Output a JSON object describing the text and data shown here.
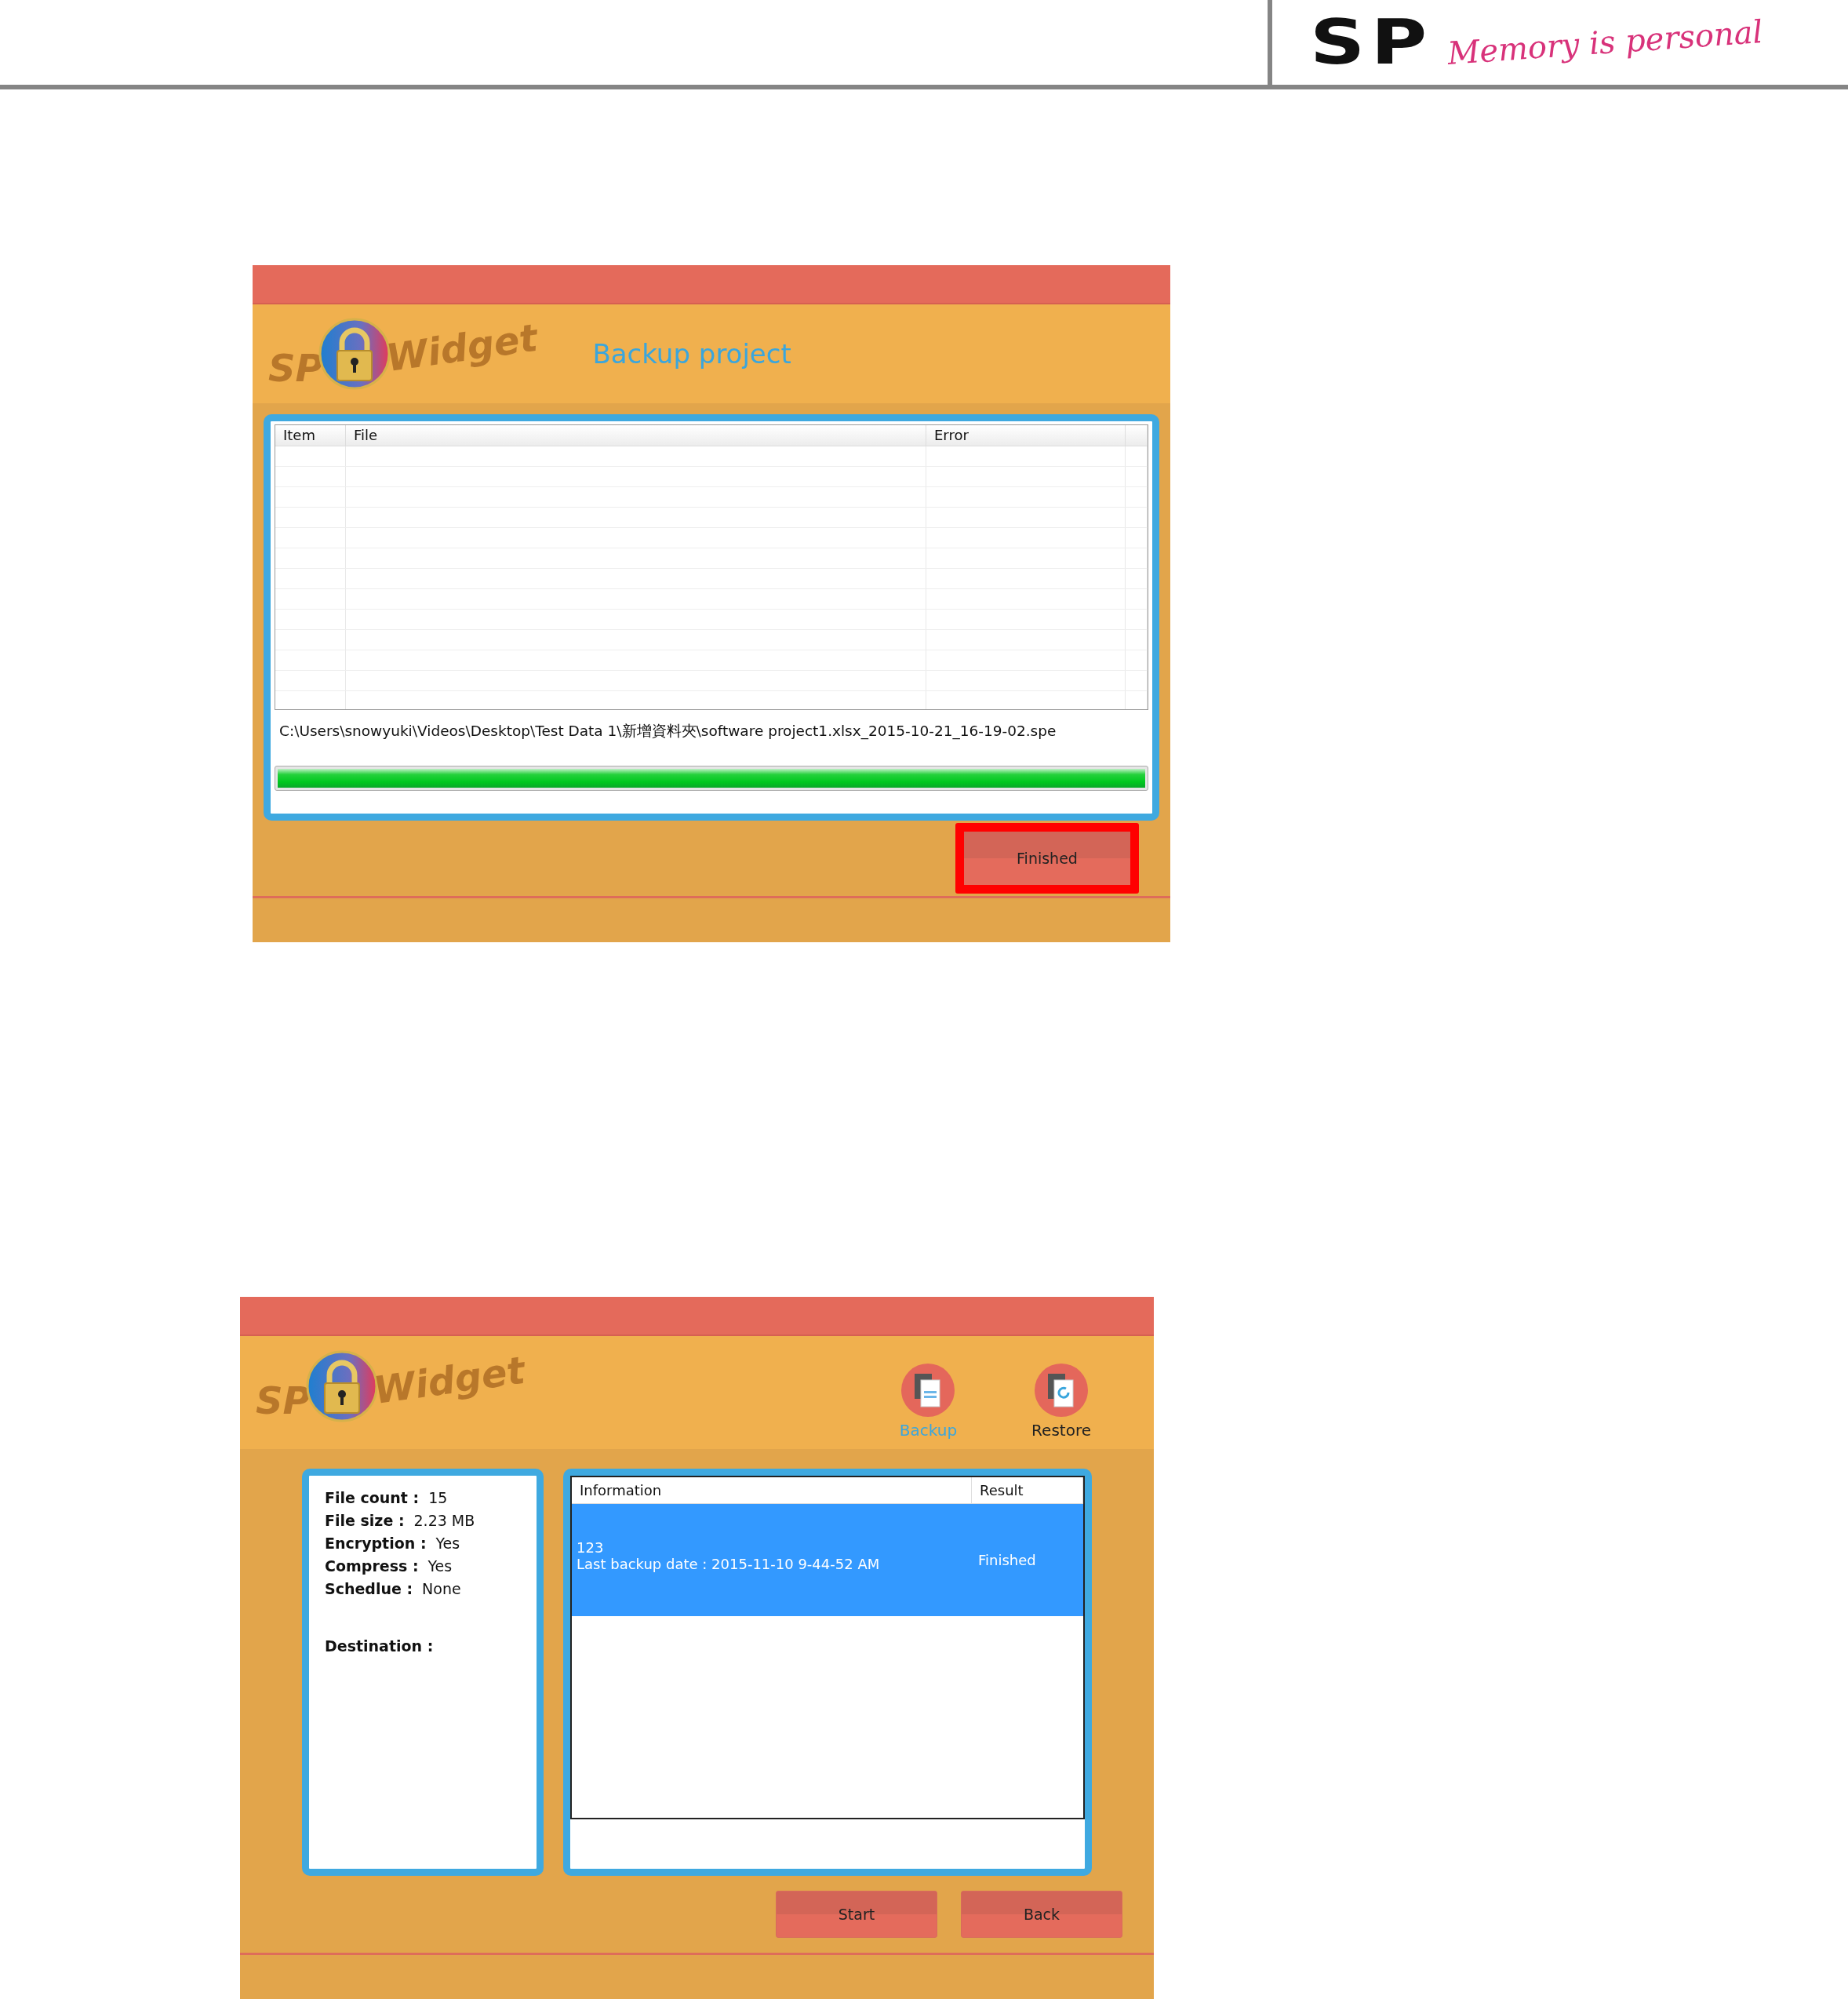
{
  "header": {
    "logo": "SP",
    "tagline": "Memory is personal"
  },
  "windows": [
    {
      "kind": "progress",
      "brand": {
        "prefix": "SP",
        "name": "Widget"
      },
      "title": "Backup project",
      "table": {
        "columns": [
          "Item",
          "File",
          "Error"
        ]
      },
      "path": "C:\\Users\\snowyuki\\Videos\\Desktop\\Test Data 1\\新增資料夾\\software project1.xlsx_2015-10-21_16-19-02.spe",
      "progress": {
        "level": 1
      },
      "buttons": [
        {
          "label": "Finished",
          "highlighted": true
        }
      ]
    },
    {
      "kind": "summary",
      "brand": {
        "prefix": "SP",
        "name": "Widget"
      },
      "nav": [
        {
          "label": "Backup",
          "selected": true,
          "kind": "backup"
        },
        {
          "label": "Restore",
          "selected": false,
          "kind": "restore"
        }
      ],
      "info": [
        {
          "label": "File count :",
          "value": "15"
        },
        {
          "label": "File size :",
          "value": "2.23 MB"
        },
        {
          "label": "Encryption :",
          "value": "Yes"
        },
        {
          "label": "Compress :",
          "value": "Yes"
        },
        {
          "label": "Schedlue :",
          "value": "None"
        },
        {
          "label": "Destination :"
        }
      ],
      "table": {
        "columns": [
          "Information",
          "Result"
        ],
        "rows": [
          {
            "lines": [
              "123",
              "Last backup date : 2015-11-10 9-44-52 AM"
            ],
            "result": "Finished",
            "selected": true
          }
        ]
      },
      "buttons": [
        {
          "label": "Start",
          "highlighted": false
        },
        {
          "label": "Back",
          "highlighted": false
        }
      ]
    }
  ]
}
